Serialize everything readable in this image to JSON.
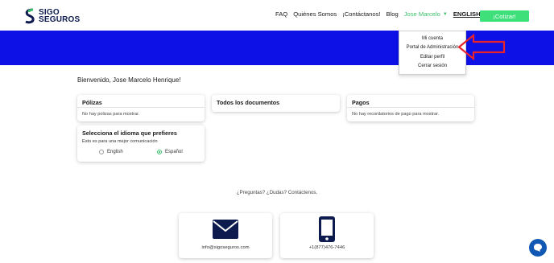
{
  "brand": {
    "line1": "SIGO",
    "line2": "SEGUROS",
    "color": "#0d1b4f",
    "accent": "#3bbf6a"
  },
  "nav": {
    "items": [
      "FAQ",
      "Quiénes Somos",
      "¡Contáctanos!",
      "Blog"
    ],
    "user": "Jose Marcelo",
    "language": "ENGLISH",
    "cta": "¡Cotizar!"
  },
  "banner": {
    "color": "#0d11e6"
  },
  "dropdown": {
    "items": [
      "Mi cuenta",
      "Portal de Administración",
      "Editar perfil",
      "Cerrar sesión"
    ]
  },
  "welcome": "Bienvenido, Jose Marcelo Henrique!",
  "cards": {
    "polizas": {
      "title": "Pólizas",
      "text": "No hay polizas para mostrar."
    },
    "documentos": {
      "title": "Todos los documentos"
    },
    "pagos": {
      "title": "Pagos",
      "text": "No hay recordatorios de pago para mostrar."
    },
    "idioma": {
      "title": "Selecciona el idioma que prefieres",
      "subtitle": "Esto es para una mejor comunicación",
      "options": [
        "English",
        "Español"
      ],
      "selected": "Español"
    }
  },
  "contact": {
    "prompt": "¿Preguntas? ¿Dudas? Contáctenos.",
    "email": "info@sigoseguros.com",
    "phone": "+1(877)476-7446"
  }
}
